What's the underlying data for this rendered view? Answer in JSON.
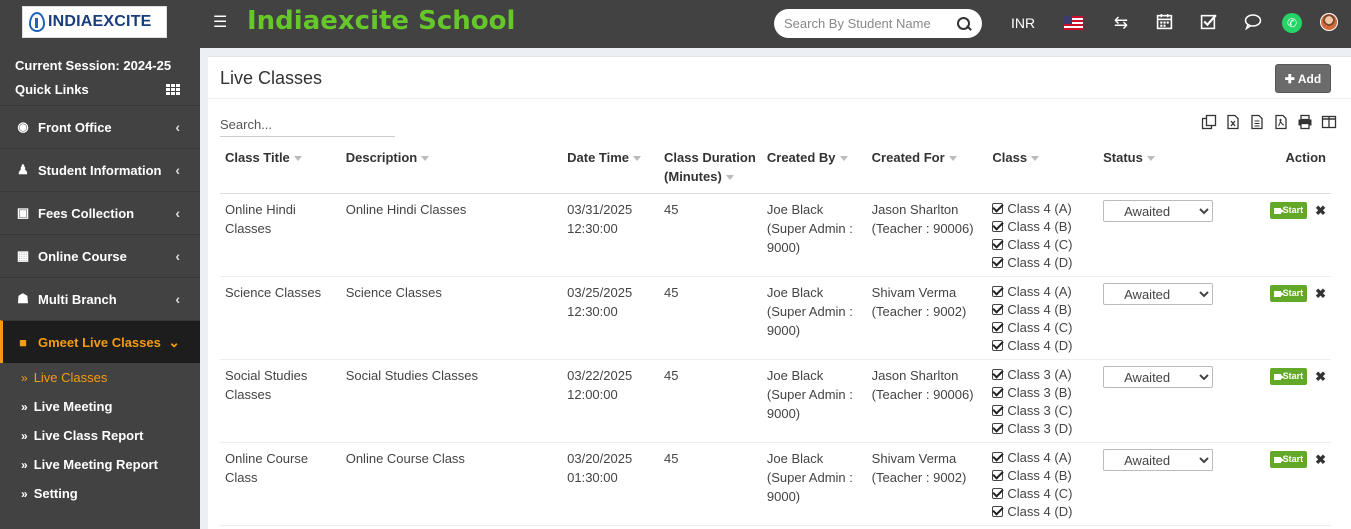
{
  "brand": {
    "logo_text": "INDIAEXCITE",
    "school_name": "Indiaexcite School"
  },
  "header": {
    "search_placeholder": "Search By Student Name",
    "currency": "INR",
    "icons": [
      "menu-icon",
      "search-icon",
      "flag-us-icon",
      "swap-icon",
      "calendar-icon",
      "tasks-icon",
      "chat-icon",
      "whatsapp-icon",
      "avatar"
    ]
  },
  "sidebar": {
    "session": "Current Session: 2024-25",
    "quick_links": "Quick Links",
    "items": [
      {
        "label": "Front Office",
        "icon": "front-office-icon"
      },
      {
        "label": "Student Information",
        "icon": "users-icon"
      },
      {
        "label": "Fees Collection",
        "icon": "money-icon"
      },
      {
        "label": "Online Course",
        "icon": "file-icon"
      },
      {
        "label": "Multi Branch",
        "icon": "sitemap-icon"
      },
      {
        "label": "Gmeet Live Classes",
        "icon": "video-icon",
        "active": true
      }
    ],
    "subitems": [
      {
        "label": "Live Classes",
        "active": true
      },
      {
        "label": "Live Meeting"
      },
      {
        "label": "Live Class Report"
      },
      {
        "label": "Live Meeting Report"
      },
      {
        "label": "Setting"
      }
    ]
  },
  "main": {
    "title": "Live Classes",
    "add_label": "Add",
    "search_placeholder": "Search...",
    "columns": {
      "class_title": "Class Title",
      "description": "Description",
      "date_time": "Date Time",
      "duration": "Class Duration (Minutes)",
      "created_by": "Created By",
      "created_for": "Created For",
      "class": "Class",
      "status": "Status",
      "action": "Action"
    },
    "start_label": "Start",
    "rows": [
      {
        "title": "Online Hindi Classes",
        "description": "Online Hindi Classes",
        "date": "03/31/2025",
        "time": "12:30:00",
        "duration": "45",
        "created_by": "Joe Black (Super Admin : 9000)",
        "created_for": "Jason Sharlton (Teacher : 90006)",
        "classes": [
          "Class 4 (A)",
          "Class 4 (B)",
          "Class 4 (C)",
          "Class 4 (D)"
        ],
        "status": "Awaited"
      },
      {
        "title": "Science Classes",
        "description": "Science Classes",
        "date": "03/25/2025",
        "time": "12:30:00",
        "duration": "45",
        "created_by": "Joe Black (Super Admin : 9000)",
        "created_for": "Shivam Verma (Teacher : 9002)",
        "classes": [
          "Class 4 (A)",
          "Class 4 (B)",
          "Class 4 (C)",
          "Class 4 (D)"
        ],
        "status": "Awaited"
      },
      {
        "title": "Social Studies Classes",
        "description": "Social Studies Classes",
        "date": "03/22/2025",
        "time": "12:00:00",
        "duration": "45",
        "created_by": "Joe Black (Super Admin : 9000)",
        "created_for": "Jason Sharlton (Teacher : 90006)",
        "classes": [
          "Class 3 (A)",
          "Class 3 (B)",
          "Class 3 (C)",
          "Class 3 (D)"
        ],
        "status": "Awaited"
      },
      {
        "title": "Online Course Class",
        "description": "Online Course Class",
        "date": "03/20/2025",
        "time": "01:30:00",
        "duration": "45",
        "created_by": "Joe Black (Super Admin : 9000)",
        "created_for": "Shivam Verma (Teacher : 9002)",
        "classes": [
          "Class 4 (A)",
          "Class 4 (B)",
          "Class 4 (C)",
          "Class 4 (D)"
        ],
        "status": "Awaited"
      }
    ]
  },
  "colors": {
    "topbar": "#424242",
    "school_name": "#66c72a",
    "accent": "#f39c12",
    "start_button": "#62a829"
  }
}
